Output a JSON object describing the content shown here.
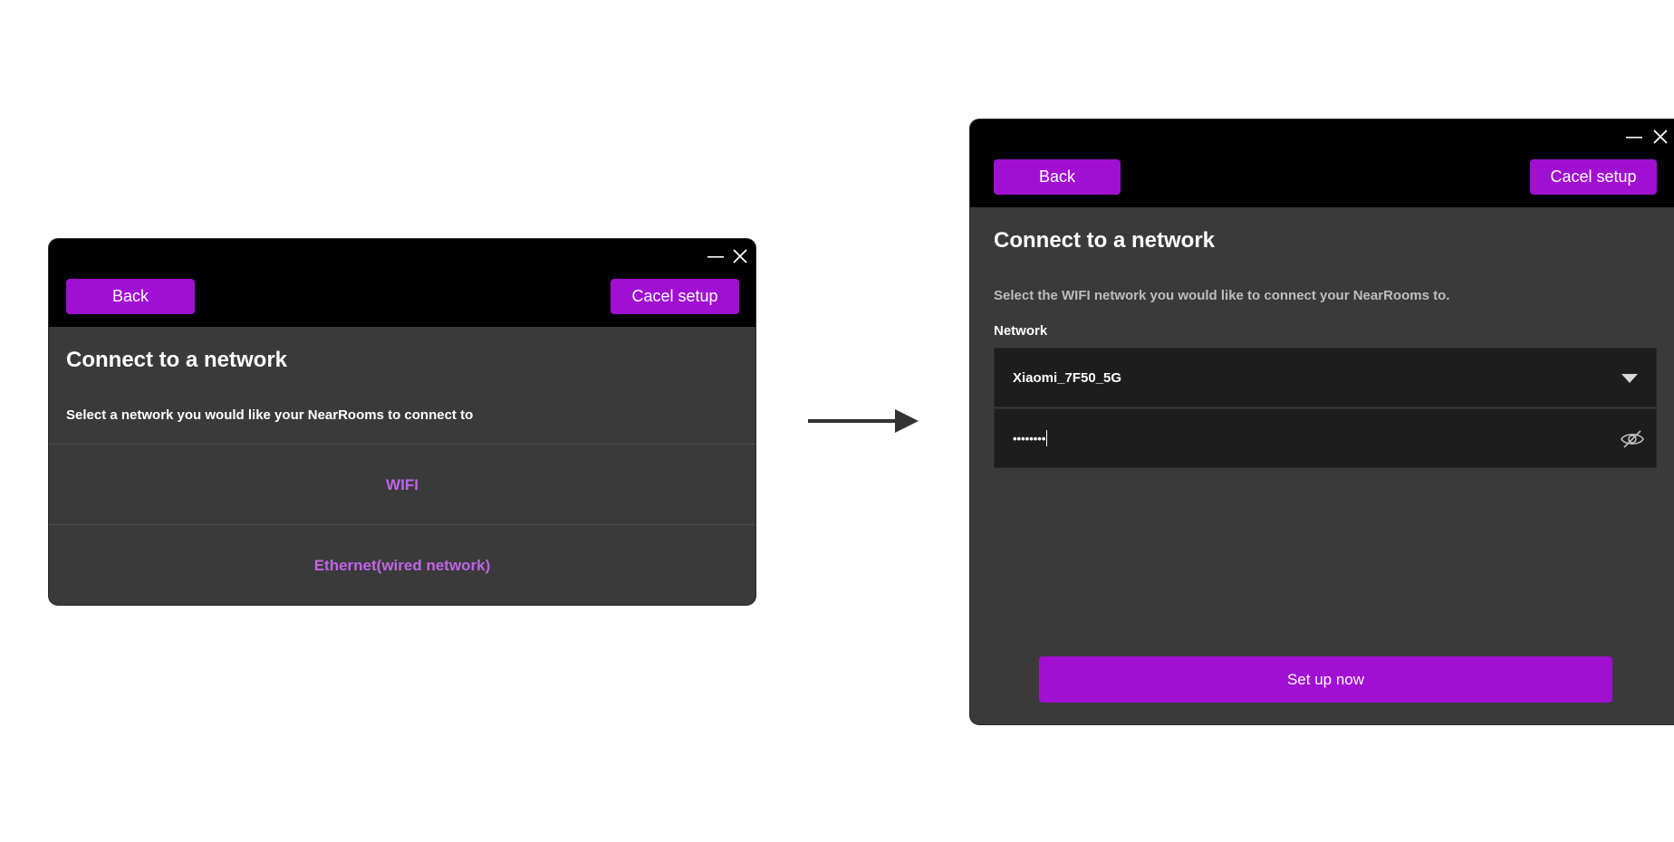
{
  "left_window": {
    "minimize_glyph": "—",
    "close_glyph": "✕",
    "back_label": "Back",
    "cancel_label": "Cacel setup",
    "title": "Connect to a network",
    "subtitle": "Select a network you would like your NearRooms to connect to",
    "options": [
      "WIFI",
      "Ethernet(wired network)"
    ]
  },
  "right_window": {
    "minimize_glyph": "—",
    "close_glyph": "✕",
    "back_label": "Back",
    "cancel_label": "Cacel setup",
    "title": "Connect to a network",
    "subtitle": "Select the WIFI network you would like to connect your NearRooms to.",
    "network_label": "Network",
    "network_value": "Xiaomi_7F50_5G",
    "password_value": "••••••••",
    "submit_label": "Set up now"
  },
  "colors": {
    "accent": "#a10fd3",
    "option_text": "#c064e8",
    "panel": "#3a3a3a",
    "header": "#000000"
  }
}
